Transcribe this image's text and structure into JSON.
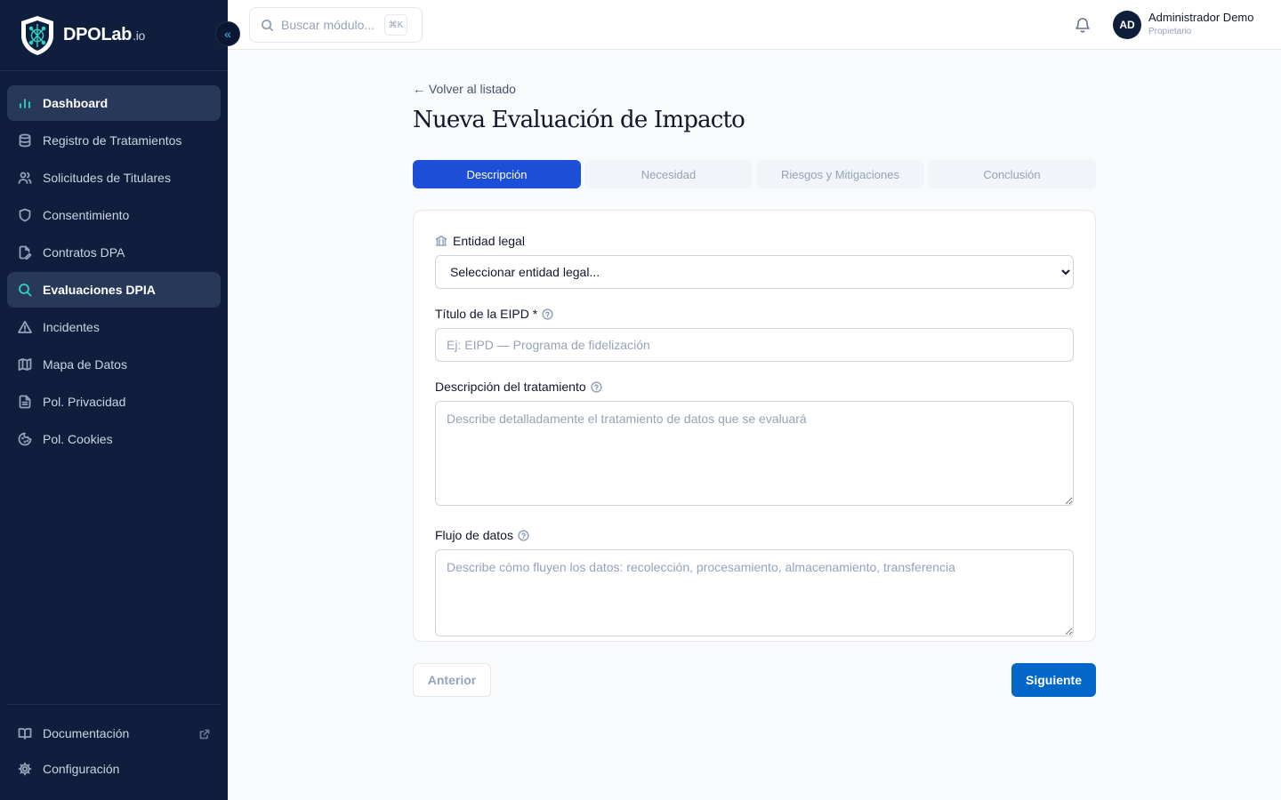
{
  "brand": {
    "name": "DPOLab",
    "tld": ".io",
    "logo_icon": "shield-logo-icon",
    "accent": "#2dd4bf"
  },
  "sidebar": {
    "collapse_label": "«",
    "items": [
      {
        "label": "Dashboard",
        "icon": "bar-chart-icon",
        "active": true
      },
      {
        "label": "Registro de Tratamientos",
        "icon": "database-icon"
      },
      {
        "label": "Solicitudes de Titulares",
        "icon": "users-icon"
      },
      {
        "label": "Consentimiento",
        "icon": "shield-icon"
      },
      {
        "label": "Contratos DPA",
        "icon": "file-edit-icon"
      },
      {
        "label": "Evaluaciones DPIA",
        "icon": "search-icon",
        "active": true
      },
      {
        "label": "Incidentes",
        "icon": "alert-triangle-icon"
      },
      {
        "label": "Mapa de Datos",
        "icon": "map-icon"
      },
      {
        "label": "Pol. Privacidad",
        "icon": "file-text-icon"
      },
      {
        "label": "Pol. Cookies",
        "icon": "cookie-icon"
      }
    ],
    "bottom": [
      {
        "label": "Documentación",
        "icon": "book-open-icon",
        "external": true
      },
      {
        "label": "Configuración",
        "icon": "gear-icon"
      }
    ]
  },
  "header": {
    "search_placeholder": "Buscar módulo...",
    "search_shortcut": "⌘K",
    "user": {
      "initials": "AD",
      "name": "Administrador Demo",
      "role": "Propietario"
    }
  },
  "main": {
    "back_label": "← Volver al listado",
    "title": "Nueva Evaluación de Impacto",
    "steps": [
      {
        "label": "Descripción",
        "active": true
      },
      {
        "label": "Necesidad"
      },
      {
        "label": "Riesgos y Mitigaciones"
      },
      {
        "label": "Conclusión"
      }
    ],
    "form": {
      "entity_label": "Entidad legal",
      "entity_value": "Seleccionar entidad legal...",
      "title_label": "Título de la EIPD *",
      "title_placeholder": "Ej: EIPD — Programa de fidelización",
      "desc_label": "Descripción del tratamiento",
      "desc_placeholder": "Describe detalladamente el tratamiento de datos que se evaluará",
      "flow_label": "Flujo de datos",
      "flow_placeholder": "Describe cómo fluyen los datos: recolección, procesamiento, almacenamiento, transferencia"
    },
    "prev_label": "Anterior",
    "next_label": "Siguiente"
  },
  "colors": {
    "sidebar_bg": "#0f1e3d",
    "primary": "#1d4ed8",
    "next_button": "#0366c9"
  }
}
